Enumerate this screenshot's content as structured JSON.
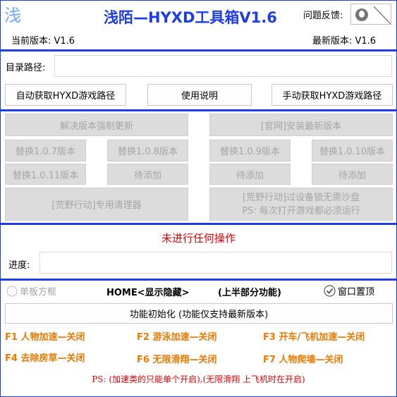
{
  "header": {
    "logo_char": "浅",
    "title": "浅陌—HYXD工具箱V1.6",
    "feedback_label": "问题反馈:",
    "current_version": "当前版本: V1.6",
    "latest_version": "最新版本: V1.6"
  },
  "path": {
    "label": "目录路径:",
    "value": ""
  },
  "top_buttons": {
    "auto_path": "自动获取HYXD游戏路径",
    "help": "使用说明",
    "manual_path": "手动获取HYXD游戏路径"
  },
  "versions": {
    "force_update": "解决版本强制更新",
    "official_install": "[官网]安装最新版本",
    "v107": "替换1.0.7版本",
    "v108": "替换1.0.8版本",
    "v109": "替换1.0.9版本",
    "v1010": "替换1.0.10版本",
    "v1011": "替换1.0.11版本",
    "pending1": "待添加",
    "pending2": "待添加",
    "pending3": "待添加",
    "cleaner": "[荒野行动]专用清理器",
    "sandbox_line1": "[荒野行动]过设备锁无需沙盘",
    "sandbox_line2": "PS: 每次打开游戏都必须运行"
  },
  "status": {
    "message": "未进行任何操作",
    "progress_label": "进度:",
    "progress_value": ""
  },
  "bottom": {
    "single_board": "单板方框",
    "home_label": "HOME<显示隐藏>",
    "upper_note": "(上半部分功能)",
    "topmost": "窗口置顶",
    "init_button": "功能初始化 (功能仅支持最新版本)"
  },
  "hotkeys": {
    "f1": "F1 人物加速—关闭",
    "f2": "F2 游泳加速—关闭",
    "f3": "F3 开车/飞机加速—关闭",
    "f4": "F4 去除房草—关闭",
    "f6": "F6 无限滑翔—关闭",
    "f7": "F7 人物爬墙—关闭"
  },
  "footer_note": "PS: (加速类的只能单个开启),(无限滑翔 上飞机时在开启)",
  "colors": {
    "accent": "#1d3ee6",
    "title": "#1d3ee6",
    "status_red": "#e60000",
    "hotkey_orange": "#f07800"
  }
}
